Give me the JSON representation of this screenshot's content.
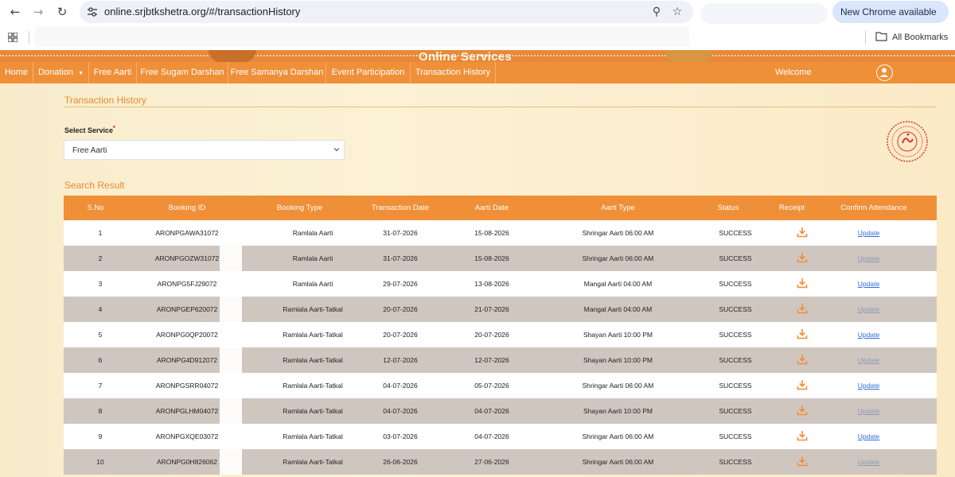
{
  "browser": {
    "url": "online.srjbtkshetra.org/#/transactionHistory",
    "update_label": "New Chrome available",
    "bookmarks_label": "All Bookmarks"
  },
  "site": {
    "banner_title": "Online Services",
    "nav": [
      "Home",
      "Donation",
      "Free Aarti",
      "Free Sugam Darshan",
      "Free Samanya Darshan",
      "Event Participation",
      "Transaction History"
    ],
    "welcome": "Welcome"
  },
  "page": {
    "title": "Transaction History",
    "select_label": "Select Service",
    "select_value": "Free Aarti",
    "result_title": "Search Result"
  },
  "table": {
    "headers": [
      "S.No",
      "Booking ID",
      "Booking Type",
      "Transaction Date",
      "Aarti Date",
      "Aarti Type",
      "Status",
      "Receipt",
      "Confirm Attendance"
    ],
    "rows": [
      {
        "sno": "1",
        "id": "ARONPGAWA31072",
        "type": "Ramlala Aarti",
        "txn": "31-07-2026",
        "aarti": "15-08-2026",
        "atype": "Shringar Aarti 06:00 AM",
        "status": "SUCCESS",
        "action": "Update"
      },
      {
        "sno": "2",
        "id": "ARONPGOZW31072",
        "type": "Ramlala Aarti",
        "txn": "31-07-2026",
        "aarti": "15-08-2026",
        "atype": "Shringar Aarti 06:00 AM",
        "status": "SUCCESS",
        "action": "Update"
      },
      {
        "sno": "3",
        "id": "ARONPG5FJ29072",
        "type": "Ramlala Aarti",
        "txn": "29-07-2026",
        "aarti": "13-08-2026",
        "atype": "Mangal Aarti 04:00 AM",
        "status": "SUCCESS",
        "action": "Update"
      },
      {
        "sno": "4",
        "id": "ARONPGEP620072",
        "type": "Ramlala Aarti-Tatkal",
        "txn": "20-07-2026",
        "aarti": "21-07-2026",
        "atype": "Mangal Aarti 04:00 AM",
        "status": "SUCCESS",
        "action": "Update"
      },
      {
        "sno": "5",
        "id": "ARONPG0QP20072",
        "type": "Ramlala Aarti-Tatkal",
        "txn": "20-07-2026",
        "aarti": "20-07-2026",
        "atype": "Shayan Aarti 10:00 PM",
        "status": "SUCCESS",
        "action": "Update"
      },
      {
        "sno": "6",
        "id": "ARONPG4D912072",
        "type": "Ramlala Aarti-Tatkal",
        "txn": "12-07-2026",
        "aarti": "12-07-2026",
        "atype": "Shayan Aarti 10:00 PM",
        "status": "SUCCESS",
        "action": "Update"
      },
      {
        "sno": "7",
        "id": "ARONPGSRR04072",
        "type": "Ramlala Aarti-Tatkal",
        "txn": "04-07-2026",
        "aarti": "05-07-2026",
        "atype": "Shringar Aarti 06:00 AM",
        "status": "SUCCESS",
        "action": "Update"
      },
      {
        "sno": "8",
        "id": "ARONPGLHM04072",
        "type": "Ramlala Aarti-Tatkal",
        "txn": "04-07-2026",
        "aarti": "04-07-2026",
        "atype": "Shayan Aarti 10:00 PM",
        "status": "SUCCESS",
        "action": "Update"
      },
      {
        "sno": "9",
        "id": "ARONPGXQE03072",
        "type": "Ramlala Aarti-Tatkal",
        "txn": "03-07-2026",
        "aarti": "04-07-2026",
        "atype": "Shringar Aarti 06:00 AM",
        "status": "SUCCESS",
        "action": "Update"
      },
      {
        "sno": "10",
        "id": "ARONPG0H826062",
        "type": "Ramlala Aarti-Tatkal",
        "txn": "26-06-2026",
        "aarti": "27-06-2026",
        "atype": "Shringar Aarti 06:00 AM",
        "status": "SUCCESS",
        "action": "Update"
      }
    ]
  },
  "colors": {
    "accent": "#ef8f38",
    "link": "#2e6cd6",
    "row_alt": "#d0c6c0"
  }
}
